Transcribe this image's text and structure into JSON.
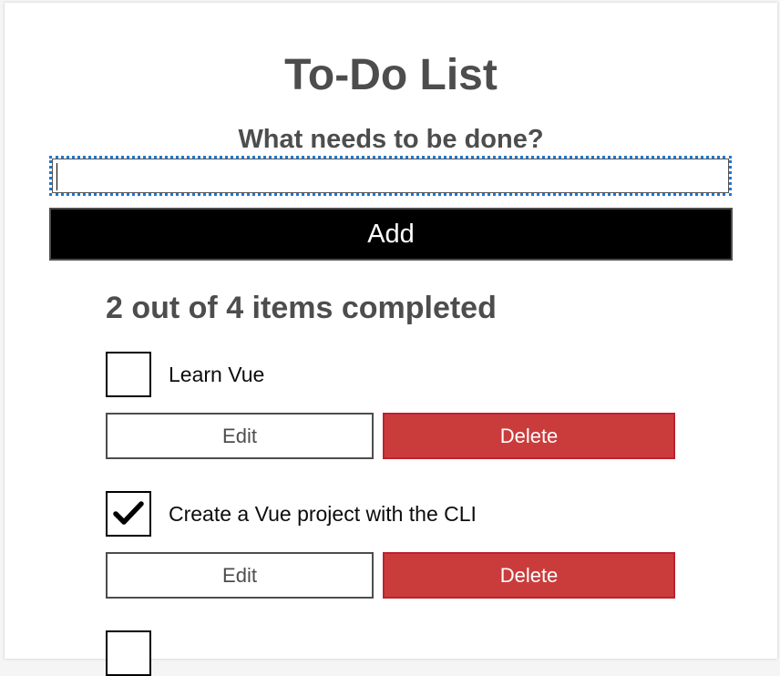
{
  "app": {
    "title": "To-Do List",
    "prompt": "What needs to be done?"
  },
  "new_todo": {
    "value": "",
    "add_label": "Add"
  },
  "status": {
    "text": "2 out of 4 items completed"
  },
  "todos": [
    {
      "label": "Learn Vue",
      "done": false,
      "edit_label": "Edit",
      "delete_label": "Delete"
    },
    {
      "label": "Create a Vue project with the CLI",
      "done": true,
      "edit_label": "Edit",
      "delete_label": "Delete"
    }
  ],
  "colors": {
    "heading": "#4d4d4d",
    "add_button_bg": "#000000",
    "delete_button_bg": "#ca3c3c",
    "focus_outline": "#1f77d0"
  },
  "icons": {
    "check": "check-icon"
  }
}
